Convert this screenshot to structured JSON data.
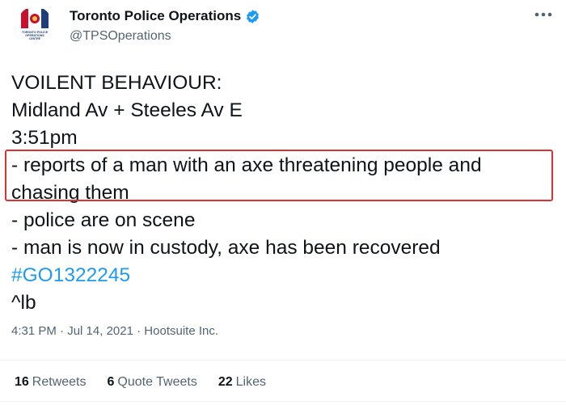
{
  "account": {
    "display_name": "Toronto Police Operations",
    "handle": "@TPSOperations",
    "logo_text_1": "TORONTO POLICE",
    "logo_text_2": "OPERATIONS",
    "logo_text_3": "CENTRE"
  },
  "tweet": {
    "lines": [
      "VOILENT BEHAVIOUR:",
      "Midland Av + Steeles Av E",
      "3:51pm",
      "- reports of a man with an axe threatening people and",
      "chasing them",
      "- police are on scene",
      "- man is now in custody, axe has been recovered"
    ],
    "hashtag": "#GO1322245",
    "signature": "^lb"
  },
  "meta": {
    "time": "4:31 PM",
    "separator": "·",
    "date": "Jul 14, 2021",
    "source": "Hootsuite Inc."
  },
  "stats": {
    "retweets_count": "16",
    "retweets_label": "Retweets",
    "quotes_count": "6",
    "quotes_label": "Quote Tweets",
    "likes_count": "22",
    "likes_label": "Likes"
  },
  "colors": {
    "accent": "#1d9bf0",
    "highlight_border": "#e03131",
    "secondary_text": "#536471"
  },
  "icons": {
    "verified": "verified-badge-icon",
    "more": "more-options-icon"
  }
}
